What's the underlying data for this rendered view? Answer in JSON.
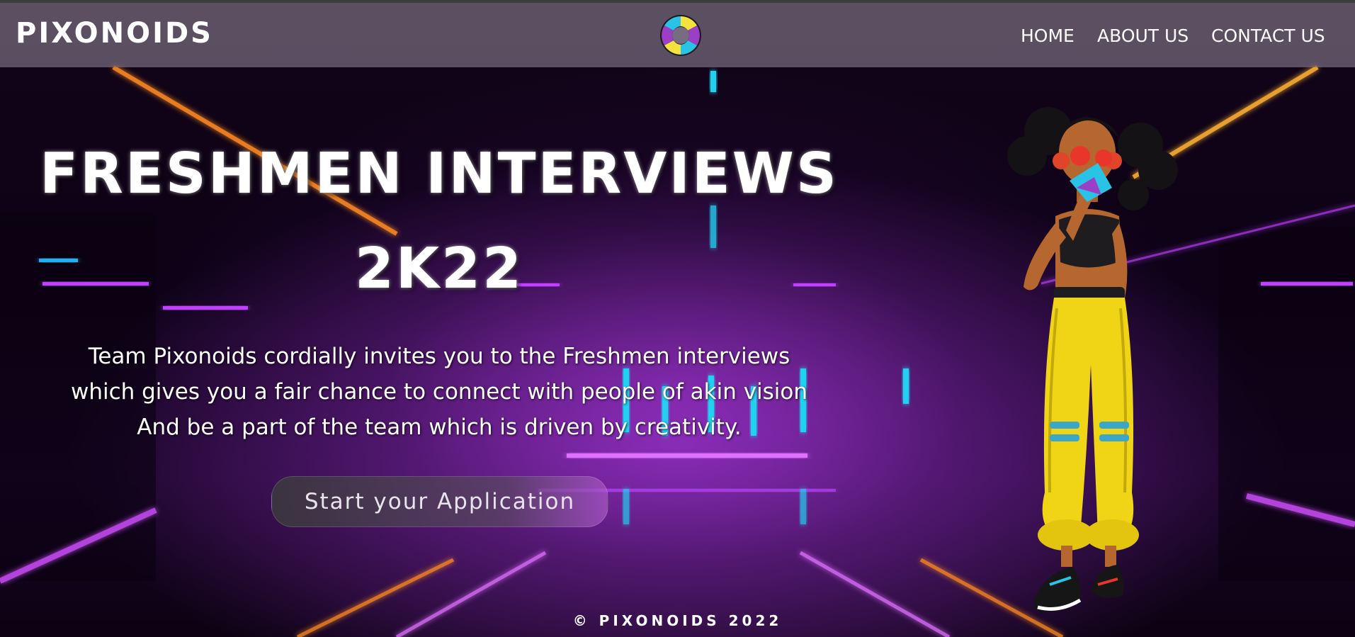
{
  "navbar": {
    "brand": "PIXONOIDS",
    "links": [
      {
        "label": "HOME"
      },
      {
        "label": "ABOUT US"
      },
      {
        "label": "CONTACT US"
      }
    ]
  },
  "hero": {
    "title_line1": "FRESHMEN INTERVIEWS",
    "title_line2": "2K22",
    "description": [
      "Team Pixonoids cordially invites you to the Freshmen interviews",
      "which gives you a fair chance to connect with people of akin vision",
      "And be a part of the team which is driven by creativity."
    ],
    "cta_label": "Start your Application"
  },
  "footer": {
    "copyright": "© PIXONOIDS 2022"
  },
  "colors": {
    "navbar_bg": "#786c80",
    "neon_purple": "#c040ff",
    "neon_cyan": "#20d0f0",
    "neon_orange": "#ff8a20",
    "logo_yellow": "#f3e33c",
    "logo_purple": "#9a3fc6",
    "logo_cyan": "#29c3e6"
  }
}
